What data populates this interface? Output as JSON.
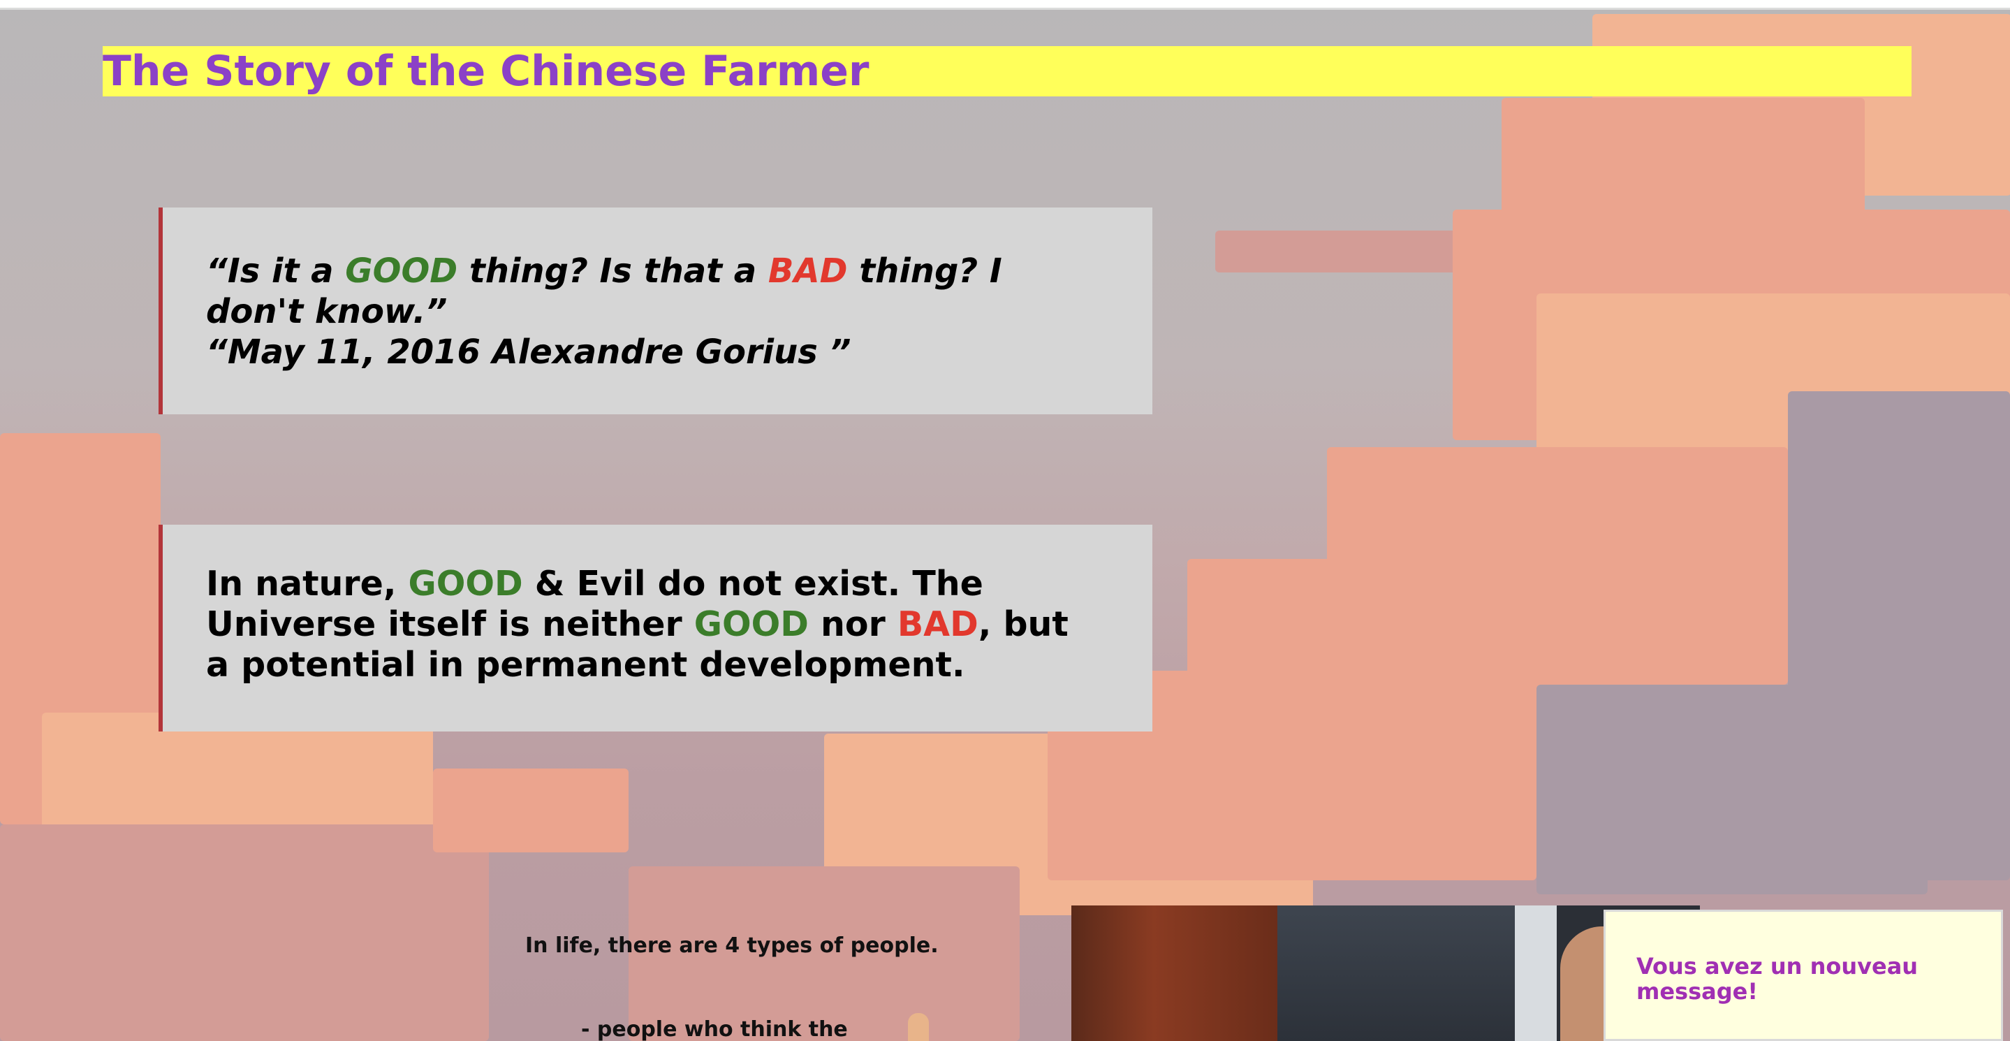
{
  "page": {
    "title": "The Story of the Chinese Farmer"
  },
  "quote": {
    "part1": "“Is it a ",
    "good": "GOOD",
    "part2": " thing? Is that a ",
    "bad": "BAD",
    "part3": " thing? I don't know.”",
    "attribution": "“May 11, 2016 Alexandre Gorius ”"
  },
  "nature": {
    "part1": "In nature, ",
    "good1": "GOOD",
    "part2": " & Evil do not exist. The Universe itself is neither ",
    "good2": "GOOD",
    "part3": " nor ",
    "bad": "BAD",
    "part4": ", but a potential in permanent development."
  },
  "types": {
    "intro": "In life, there are 4 types of people.",
    "first_partial": "- people who think the"
  },
  "notification": {
    "message": "Vous avez un nouveau message!"
  },
  "colors": {
    "title_bg": "#ffff5a",
    "title_text": "#8b41c7",
    "good": "#3b7d2a",
    "bad": "#e2382d",
    "panel_border": "#b3353a",
    "notification_text": "#a02fb3"
  }
}
